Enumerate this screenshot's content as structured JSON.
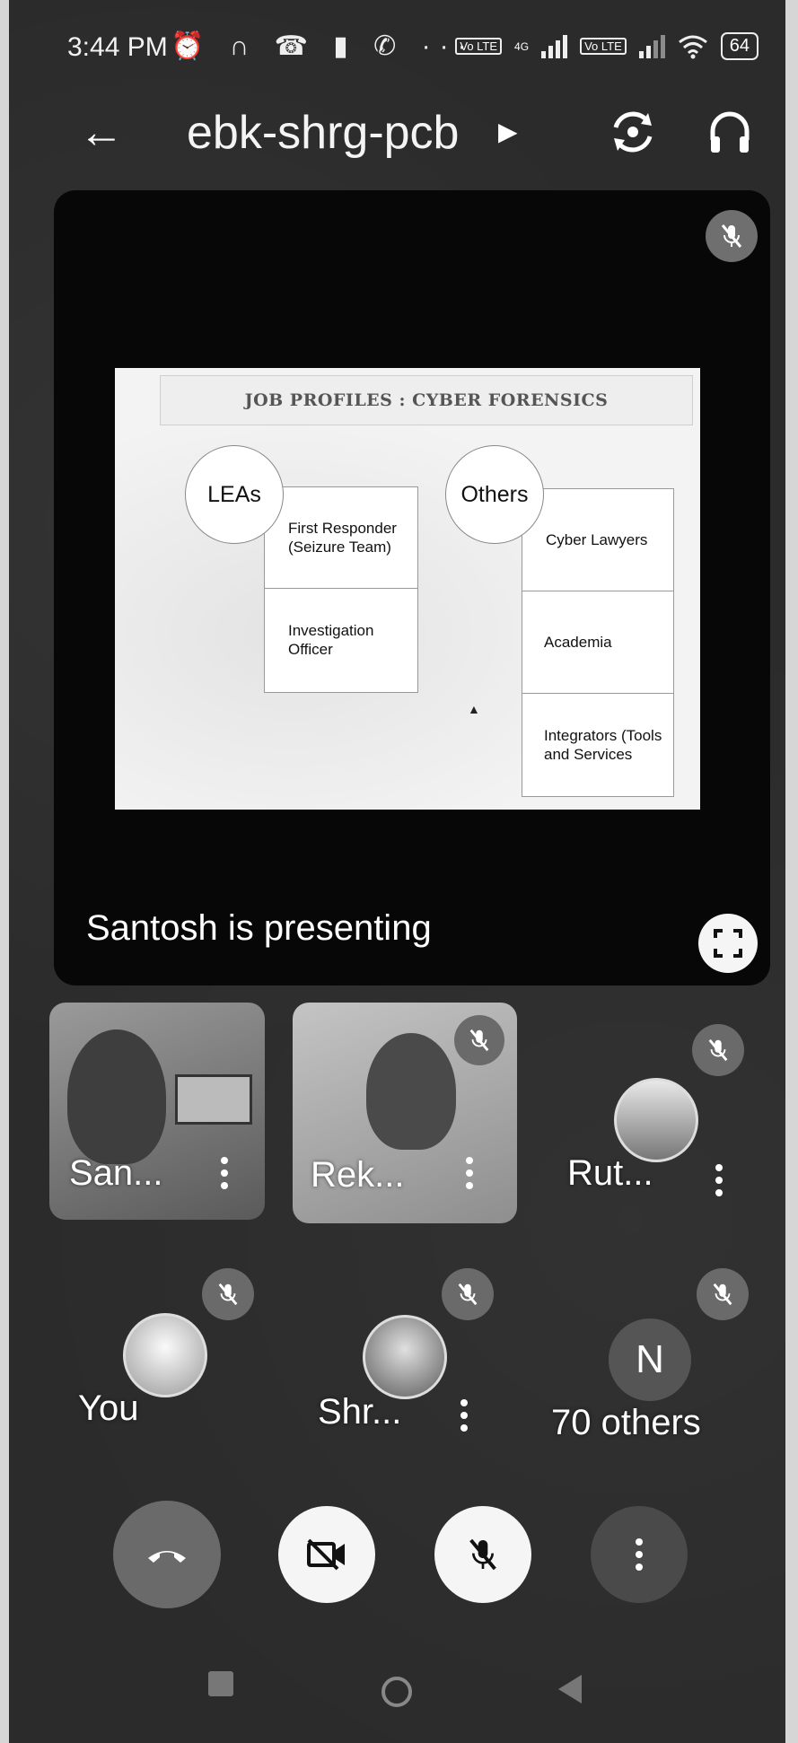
{
  "status_bar": {
    "time": "3:44 PM",
    "left_icons": "⏰ ∩ ☎ ▮ ✆ ···",
    "volte1": "Vo LTE",
    "net": "4G",
    "volte2": "Vo LTE",
    "battery": "64"
  },
  "appbar": {
    "meeting_code": "ebk-shrg-pcb"
  },
  "presentation": {
    "slide_title": "JOB PROFILES : CYBER FORENSICS",
    "left_group": {
      "label": "LEAs",
      "items": [
        "First Responder (Seizure Team)",
        "Investigation Officer"
      ]
    },
    "right_group": {
      "label": "Others",
      "items": [
        "Cyber Lawyers",
        "Academia",
        "Integrators (Tools and Services"
      ]
    },
    "presenting_label": "Santosh is presenting"
  },
  "participants": [
    {
      "name": "San..."
    },
    {
      "name": "Rek..."
    },
    {
      "name": "Rut..."
    },
    {
      "name": "You"
    },
    {
      "name": "Shr..."
    },
    {
      "name": "70 others",
      "initial": "N"
    }
  ],
  "colors": {
    "tile_bg": "#070707",
    "mute_badge": "#777777",
    "end_call": "#6a6a6a",
    "control_light": "#f5f5f5"
  }
}
